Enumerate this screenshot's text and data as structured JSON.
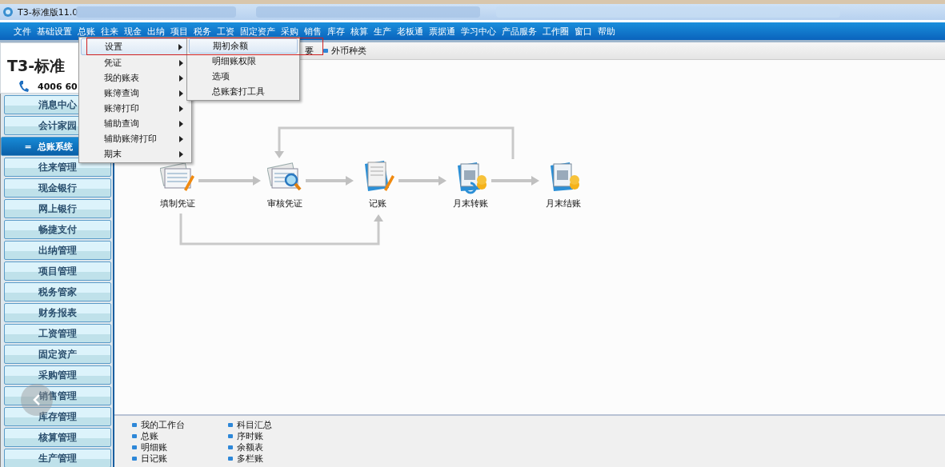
{
  "window": {
    "title": "T3-标准版11.0"
  },
  "menu_bar": [
    {
      "label": "文件"
    },
    {
      "label": "基础设置"
    },
    {
      "label": "总账"
    },
    {
      "label": "往来"
    },
    {
      "label": "现金"
    },
    {
      "label": "出纳"
    },
    {
      "label": "项目"
    },
    {
      "label": "税务"
    },
    {
      "label": "工资"
    },
    {
      "label": "固定资产"
    },
    {
      "label": "采购"
    },
    {
      "label": "销售"
    },
    {
      "label": "库存"
    },
    {
      "label": "核算"
    },
    {
      "label": "生产"
    },
    {
      "label": "老板通"
    },
    {
      "label": "票据通"
    },
    {
      "label": "学习中心"
    },
    {
      "label": "产品服务"
    },
    {
      "label": "工作圈"
    },
    {
      "label": "窗口"
    },
    {
      "label": "帮助"
    }
  ],
  "brand": {
    "logo": "T3-标准",
    "phone": "4006 60"
  },
  "toolbar": [
    {
      "label": "要",
      "bullet": false
    },
    {
      "label": "外币种类",
      "bullet": true
    }
  ],
  "dropdown_menu": [
    {
      "label": "设置",
      "selected": true
    },
    {
      "label": "凭证",
      "selected": false
    },
    {
      "label": "我的账表",
      "selected": false
    },
    {
      "label": "账簿查询",
      "selected": false
    },
    {
      "label": "账簿打印",
      "selected": false
    },
    {
      "label": "辅助查询",
      "selected": false
    },
    {
      "label": "辅助账簿打印",
      "selected": false
    },
    {
      "label": "期末",
      "selected": false
    }
  ],
  "submenu": [
    {
      "label": "期初余额",
      "selected": true
    },
    {
      "label": "明细账权限",
      "selected": false
    },
    {
      "label": "选项",
      "selected": false
    },
    {
      "label": "总账套打工具",
      "selected": false
    }
  ],
  "sidebar": {
    "items": [
      {
        "label": "消息中心",
        "selected": false
      },
      {
        "label": "会计家园",
        "selected": false
      },
      {
        "label": "总账系统",
        "selected": true,
        "marker": "="
      },
      {
        "label": "往来管理",
        "selected": false
      },
      {
        "label": "现金银行",
        "selected": false
      },
      {
        "label": "网上银行",
        "selected": false
      },
      {
        "label": "畅捷支付",
        "selected": false
      },
      {
        "label": "出纳管理",
        "selected": false
      },
      {
        "label": "项目管理",
        "selected": false
      },
      {
        "label": "税务管家",
        "selected": false
      },
      {
        "label": "财务报表",
        "selected": false
      },
      {
        "label": "工资管理",
        "selected": false
      },
      {
        "label": "固定资产",
        "selected": false
      },
      {
        "label": "采购管理",
        "selected": false
      },
      {
        "label": "销售管理",
        "selected": false
      },
      {
        "label": "库存管理",
        "selected": false
      },
      {
        "label": "核算管理",
        "selected": false
      },
      {
        "label": "生产管理",
        "selected": false
      }
    ]
  },
  "flow": [
    {
      "label": "填制凭证",
      "kind": "form"
    },
    {
      "label": "审核凭证",
      "kind": "review"
    },
    {
      "label": "记账",
      "kind": "ledger"
    },
    {
      "label": "月末转账",
      "kind": "transfer"
    },
    {
      "label": "月末结账",
      "kind": "close"
    }
  ],
  "quick_links": [
    {
      "label": "我的工作台"
    },
    {
      "label": "总账"
    },
    {
      "label": "明细账"
    },
    {
      "label": "日记账"
    },
    {
      "label": "科目汇总"
    },
    {
      "label": "序时账"
    },
    {
      "label": "余额表"
    },
    {
      "label": "多栏账"
    }
  ]
}
